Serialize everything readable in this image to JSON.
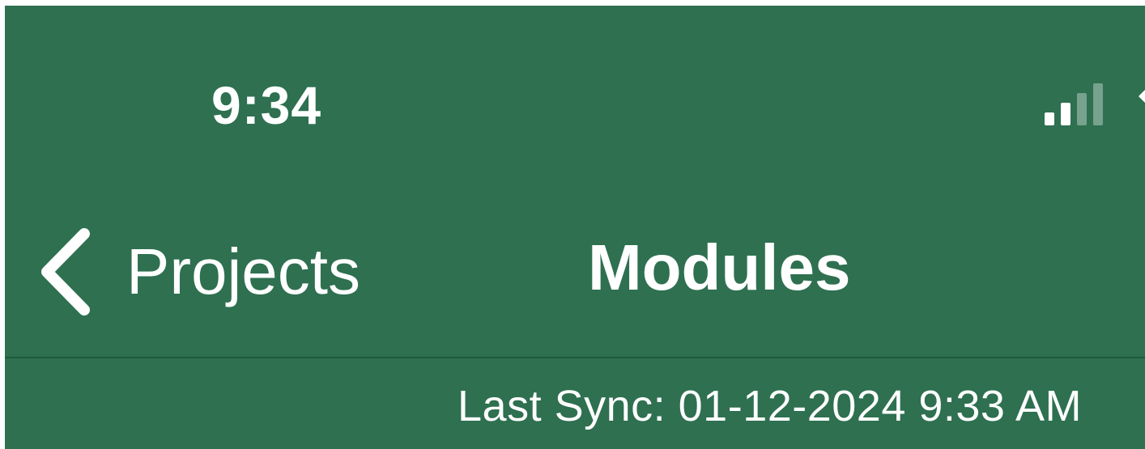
{
  "status_bar": {
    "time": "9:34",
    "signal_icon": "cellular-signal-icon",
    "signal_bars_active": 2,
    "signal_bars_total": 4,
    "wifi_icon": "wifi-icon"
  },
  "nav_bar": {
    "back_icon": "chevron-left-icon",
    "back_label": "Projects",
    "title": "Modules"
  },
  "sync": {
    "text": "Last Sync: 01-12-2024 9:33 AM"
  },
  "colors": {
    "background": "#2e7050",
    "foreground": "#ffffff",
    "divider": "#1f5a3d"
  }
}
